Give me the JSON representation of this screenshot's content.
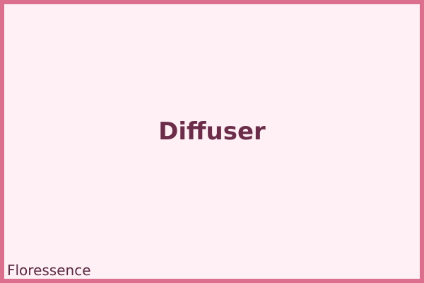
{
  "card": {
    "title": "Diffuser",
    "brand": "Floressence"
  },
  "colors": {
    "border": "#dc6e8e",
    "background": "#fff0f5",
    "title_text": "#6b2d4a",
    "brand_text": "#5a2a42"
  }
}
